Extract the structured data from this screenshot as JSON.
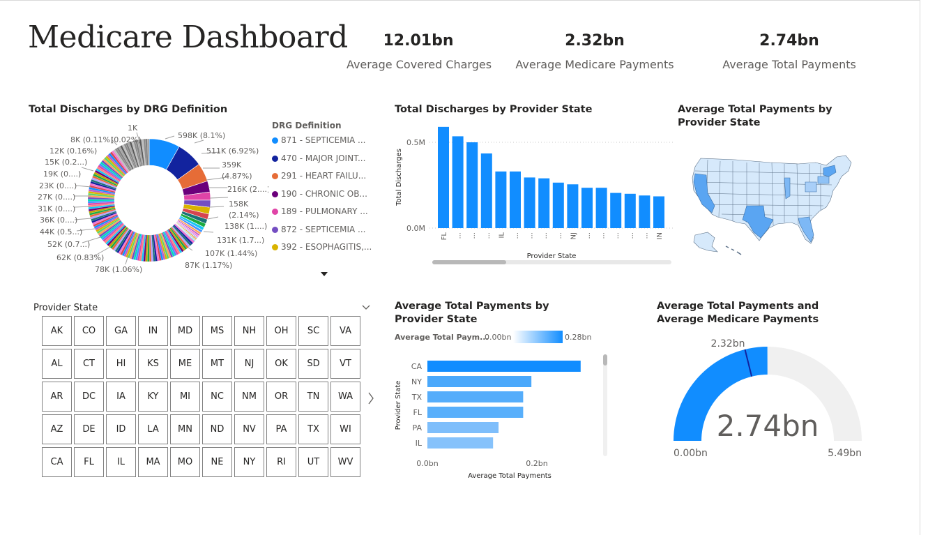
{
  "page": {
    "title": "Medicare Dashboard"
  },
  "kpis": [
    {
      "value": "12.01bn",
      "label": "Average Covered Charges"
    },
    {
      "value": "2.32bn",
      "label": "Average Medicare Payments"
    },
    {
      "value": "2.74bn",
      "label": "Average Total Payments"
    }
  ],
  "donut": {
    "title": "Total Discharges by DRG Definition",
    "legend_title": "DRG Definition",
    "legend": [
      {
        "label": "871 - SEPTICEMIA ...",
        "color": "#118DFF"
      },
      {
        "label": "470 - MAJOR JOINT...",
        "color": "#12239E"
      },
      {
        "label": "291 - HEART FAILU...",
        "color": "#E66C37"
      },
      {
        "label": "190 - CHRONIC OB...",
        "color": "#6B007B"
      },
      {
        "label": "189 - PULMONARY ...",
        "color": "#E044A7"
      },
      {
        "label": "872 - SEPTICEMIA ...",
        "color": "#744EC2"
      },
      {
        "label": "392 - ESOPHAGITIS,...",
        "color": "#D9B300"
      }
    ],
    "labels": {
      "l1": "598K (8.1%)",
      "l2": "511K (6.92%)",
      "l3a": "359K",
      "l3b": "(4.87%)",
      "l4": "216K (2....)",
      "l5a": "158K",
      "l5b": "(2.14%)",
      "l6": "138K (1....)",
      "l7": "131K (1.7...)",
      "l8": "107K (1.44%)",
      "l9": "87K (1.17%)",
      "l10": "78K (1.06%)",
      "l11": "62K (0.83%)",
      "l12": "52K (0.7...)",
      "l13": "44K (0.5...)",
      "l14": "36K (0....)",
      "l15": "31K (0....)",
      "l16": "27K (0....)",
      "l17": "23K (0....)",
      "l18": "19K (0....)",
      "l19": "15K (0.2...)",
      "l20": "12K (0.16%)",
      "l21": "8K (0.11%)",
      "l22": "(0.02%)",
      "l23": "1K"
    }
  },
  "bar_states": {
    "title": "Total Discharges by Provider State",
    "ylabel": "Total Discharges",
    "xlabel": "Provider State",
    "ticks_y": [
      "0.5M",
      "0.0M"
    ],
    "x_labels": [
      "FL",
      "...",
      "...",
      "...",
      "IL",
      "...",
      "...",
      "...",
      "...",
      "NJ",
      "...",
      "...",
      "...",
      "...",
      "...",
      "IN"
    ]
  },
  "map": {
    "title": "Average Total Payments by Provider State"
  },
  "slicer": {
    "header": "Provider State",
    "states": [
      "AK",
      "CO",
      "GA",
      "IN",
      "MD",
      "MS",
      "NH",
      "OH",
      "SC",
      "VA",
      "AL",
      "CT",
      "HI",
      "KS",
      "ME",
      "MT",
      "NJ",
      "OK",
      "SD",
      "VT",
      "AR",
      "DC",
      "IA",
      "KY",
      "MI",
      "NC",
      "NM",
      "OR",
      "TN",
      "WA",
      "AZ",
      "DE",
      "ID",
      "LA",
      "MN",
      "ND",
      "NV",
      "PA",
      "TX",
      "WI",
      "CA",
      "FL",
      "IL",
      "MA",
      "MO",
      "NE",
      "NY",
      "RI",
      "UT",
      "WV"
    ]
  },
  "hbar": {
    "title": "Average Total Payments by Provider State",
    "legend_label": "Average Total Paym...",
    "legend_min": "0.00bn",
    "legend_max": "0.28bn",
    "ylabel": "Provider State",
    "xlabel": "Average Total Payments",
    "x_ticks": [
      "0.0bn",
      "0.2bn"
    ]
  },
  "gauge": {
    "title": "Average Total Payments and Average Medicare Payments",
    "value_label": "2.74bn",
    "target_label": "2.32bn",
    "min_label": "0.00bn",
    "max_label": "5.49bn"
  },
  "chart_data": [
    {
      "type": "pie",
      "title": "Total Discharges by DRG Definition",
      "categories": [
        "871 - SEPTICEMIA ...",
        "470 - MAJOR JOINT...",
        "291 - HEART FAILU...",
        "190 - CHRONIC OB...",
        "189 - PULMONARY ...",
        "872 - SEPTICEMIA ...",
        "392 - ESOPHAGITIS,..."
      ],
      "values": [
        598000,
        511000,
        359000,
        216000,
        158000,
        138000,
        131000,
        107000,
        87000,
        78000,
        62000,
        52000,
        44000,
        36000,
        31000,
        27000,
        23000,
        19000,
        15000,
        12000,
        8000,
        1000
      ],
      "percent": [
        8.1,
        6.92,
        4.87,
        null,
        2.14,
        null,
        null,
        1.44,
        1.17,
        1.06,
        0.83,
        null,
        null,
        null,
        null,
        null,
        null,
        null,
        null,
        0.16,
        0.11,
        0.02
      ]
    },
    {
      "type": "bar",
      "title": "Total Discharges by Provider State",
      "xlabel": "Provider State",
      "ylabel": "Total Discharges",
      "x_labels_shown": [
        "FL",
        "IL",
        "NJ",
        "IN"
      ],
      "values": [
        590000,
        535000,
        500000,
        435000,
        330000,
        330000,
        295000,
        290000,
        265000,
        255000,
        235000,
        235000,
        205000,
        200000,
        190000,
        185000
      ],
      "ylim": [
        0,
        600000
      ]
    },
    {
      "type": "bar",
      "title": "Average Total Payments by Provider State",
      "orientation": "horizontal",
      "xlabel": "Average Total Payments",
      "ylabel": "Provider State",
      "categories": [
        "CA",
        "NY",
        "TX",
        "FL",
        "PA",
        "IL"
      ],
      "values": [
        0.28,
        0.19,
        0.175,
        0.175,
        0.13,
        0.12
      ],
      "unit": "bn",
      "xlim": [
        0,
        0.28
      ]
    }
  ]
}
